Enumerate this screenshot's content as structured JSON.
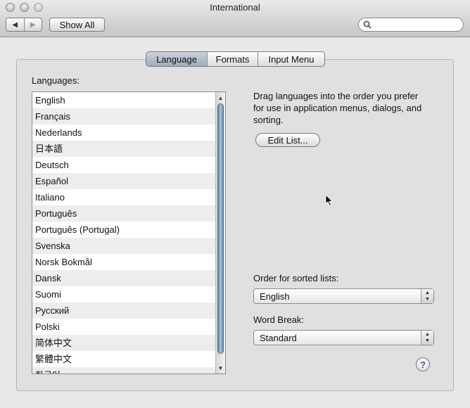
{
  "window": {
    "title": "International"
  },
  "toolbar": {
    "back_icon": "back-arrow-icon",
    "forward_icon": "forward-arrow-icon",
    "show_all": "Show All",
    "search_placeholder": "",
    "search_value": ""
  },
  "tabs": [
    {
      "label": "Language",
      "active": true
    },
    {
      "label": "Formats",
      "active": false
    },
    {
      "label": "Input Menu",
      "active": false
    }
  ],
  "languages": {
    "label": "Languages:",
    "items": [
      "English",
      "Français",
      "Nederlands",
      "日本語",
      "Deutsch",
      "Español",
      "Italiano",
      "Português",
      "Português (Portugal)",
      "Svenska",
      "Norsk Bokmål",
      "Dansk",
      "Suomi",
      "Русский",
      "Polski",
      "简体中文",
      "繁體中文",
      "한국어"
    ]
  },
  "description": "Drag languages into the order you prefer for use in application menus, dialogs, and sorting.",
  "edit_list": "Edit List...",
  "sorted": {
    "label": "Order for sorted lists:",
    "value": "English"
  },
  "word_break": {
    "label": "Word Break:",
    "value": "Standard"
  },
  "help": "?",
  "colors": {
    "accent": "#9eabbb",
    "scroll_thumb": "#7f9ec0"
  }
}
